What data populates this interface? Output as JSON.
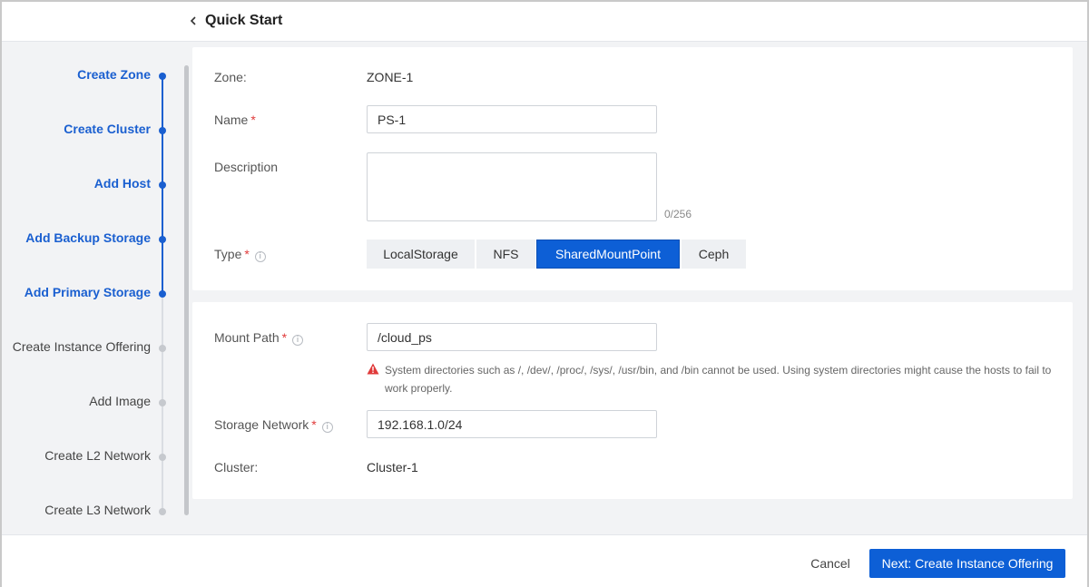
{
  "header": {
    "title": "Quick Start",
    "back_icon": "chevron-left-icon"
  },
  "steps": [
    {
      "label": "Create Zone",
      "status": "done"
    },
    {
      "label": "Create Cluster",
      "status": "done"
    },
    {
      "label": "Add Host",
      "status": "done"
    },
    {
      "label": "Add Backup Storage",
      "status": "done"
    },
    {
      "label": "Add Primary Storage",
      "status": "current"
    },
    {
      "label": "Create Instance Offering",
      "status": "todo"
    },
    {
      "label": "Add Image",
      "status": "todo"
    },
    {
      "label": "Create L2 Network",
      "status": "todo"
    },
    {
      "label": "Create L3 Network",
      "status": "todo"
    }
  ],
  "form": {
    "zone_label": "Zone:",
    "zone_value": "ZONE-1",
    "name_label": "Name",
    "name_value": "PS-1",
    "description_label": "Description",
    "description_value": "",
    "description_counter": "0/256",
    "type_label": "Type",
    "type_options": [
      "LocalStorage",
      "NFS",
      "SharedMountPoint",
      "Ceph"
    ],
    "type_selected": "SharedMountPoint",
    "required_mark": "*",
    "mount_path_label": "Mount Path",
    "mount_path_value": "/cloud_ps",
    "mount_path_warning": "System directories such as /, /dev/, /proc/, /sys/, /usr/bin, and /bin cannot be used. Using system directories might cause the hosts to fail to work properly.",
    "storage_network_label": "Storage Network",
    "storage_network_value": "192.168.1.0/24",
    "cluster_label": "Cluster:",
    "cluster_value": "Cluster-1"
  },
  "footer": {
    "cancel_label": "Cancel",
    "next_label": "Next: Create Instance Offering"
  },
  "colors": {
    "accent": "#0d5fd6",
    "step_done": "#1a5fd0",
    "required": "#e03a3a",
    "warning": "#e03a3a"
  }
}
